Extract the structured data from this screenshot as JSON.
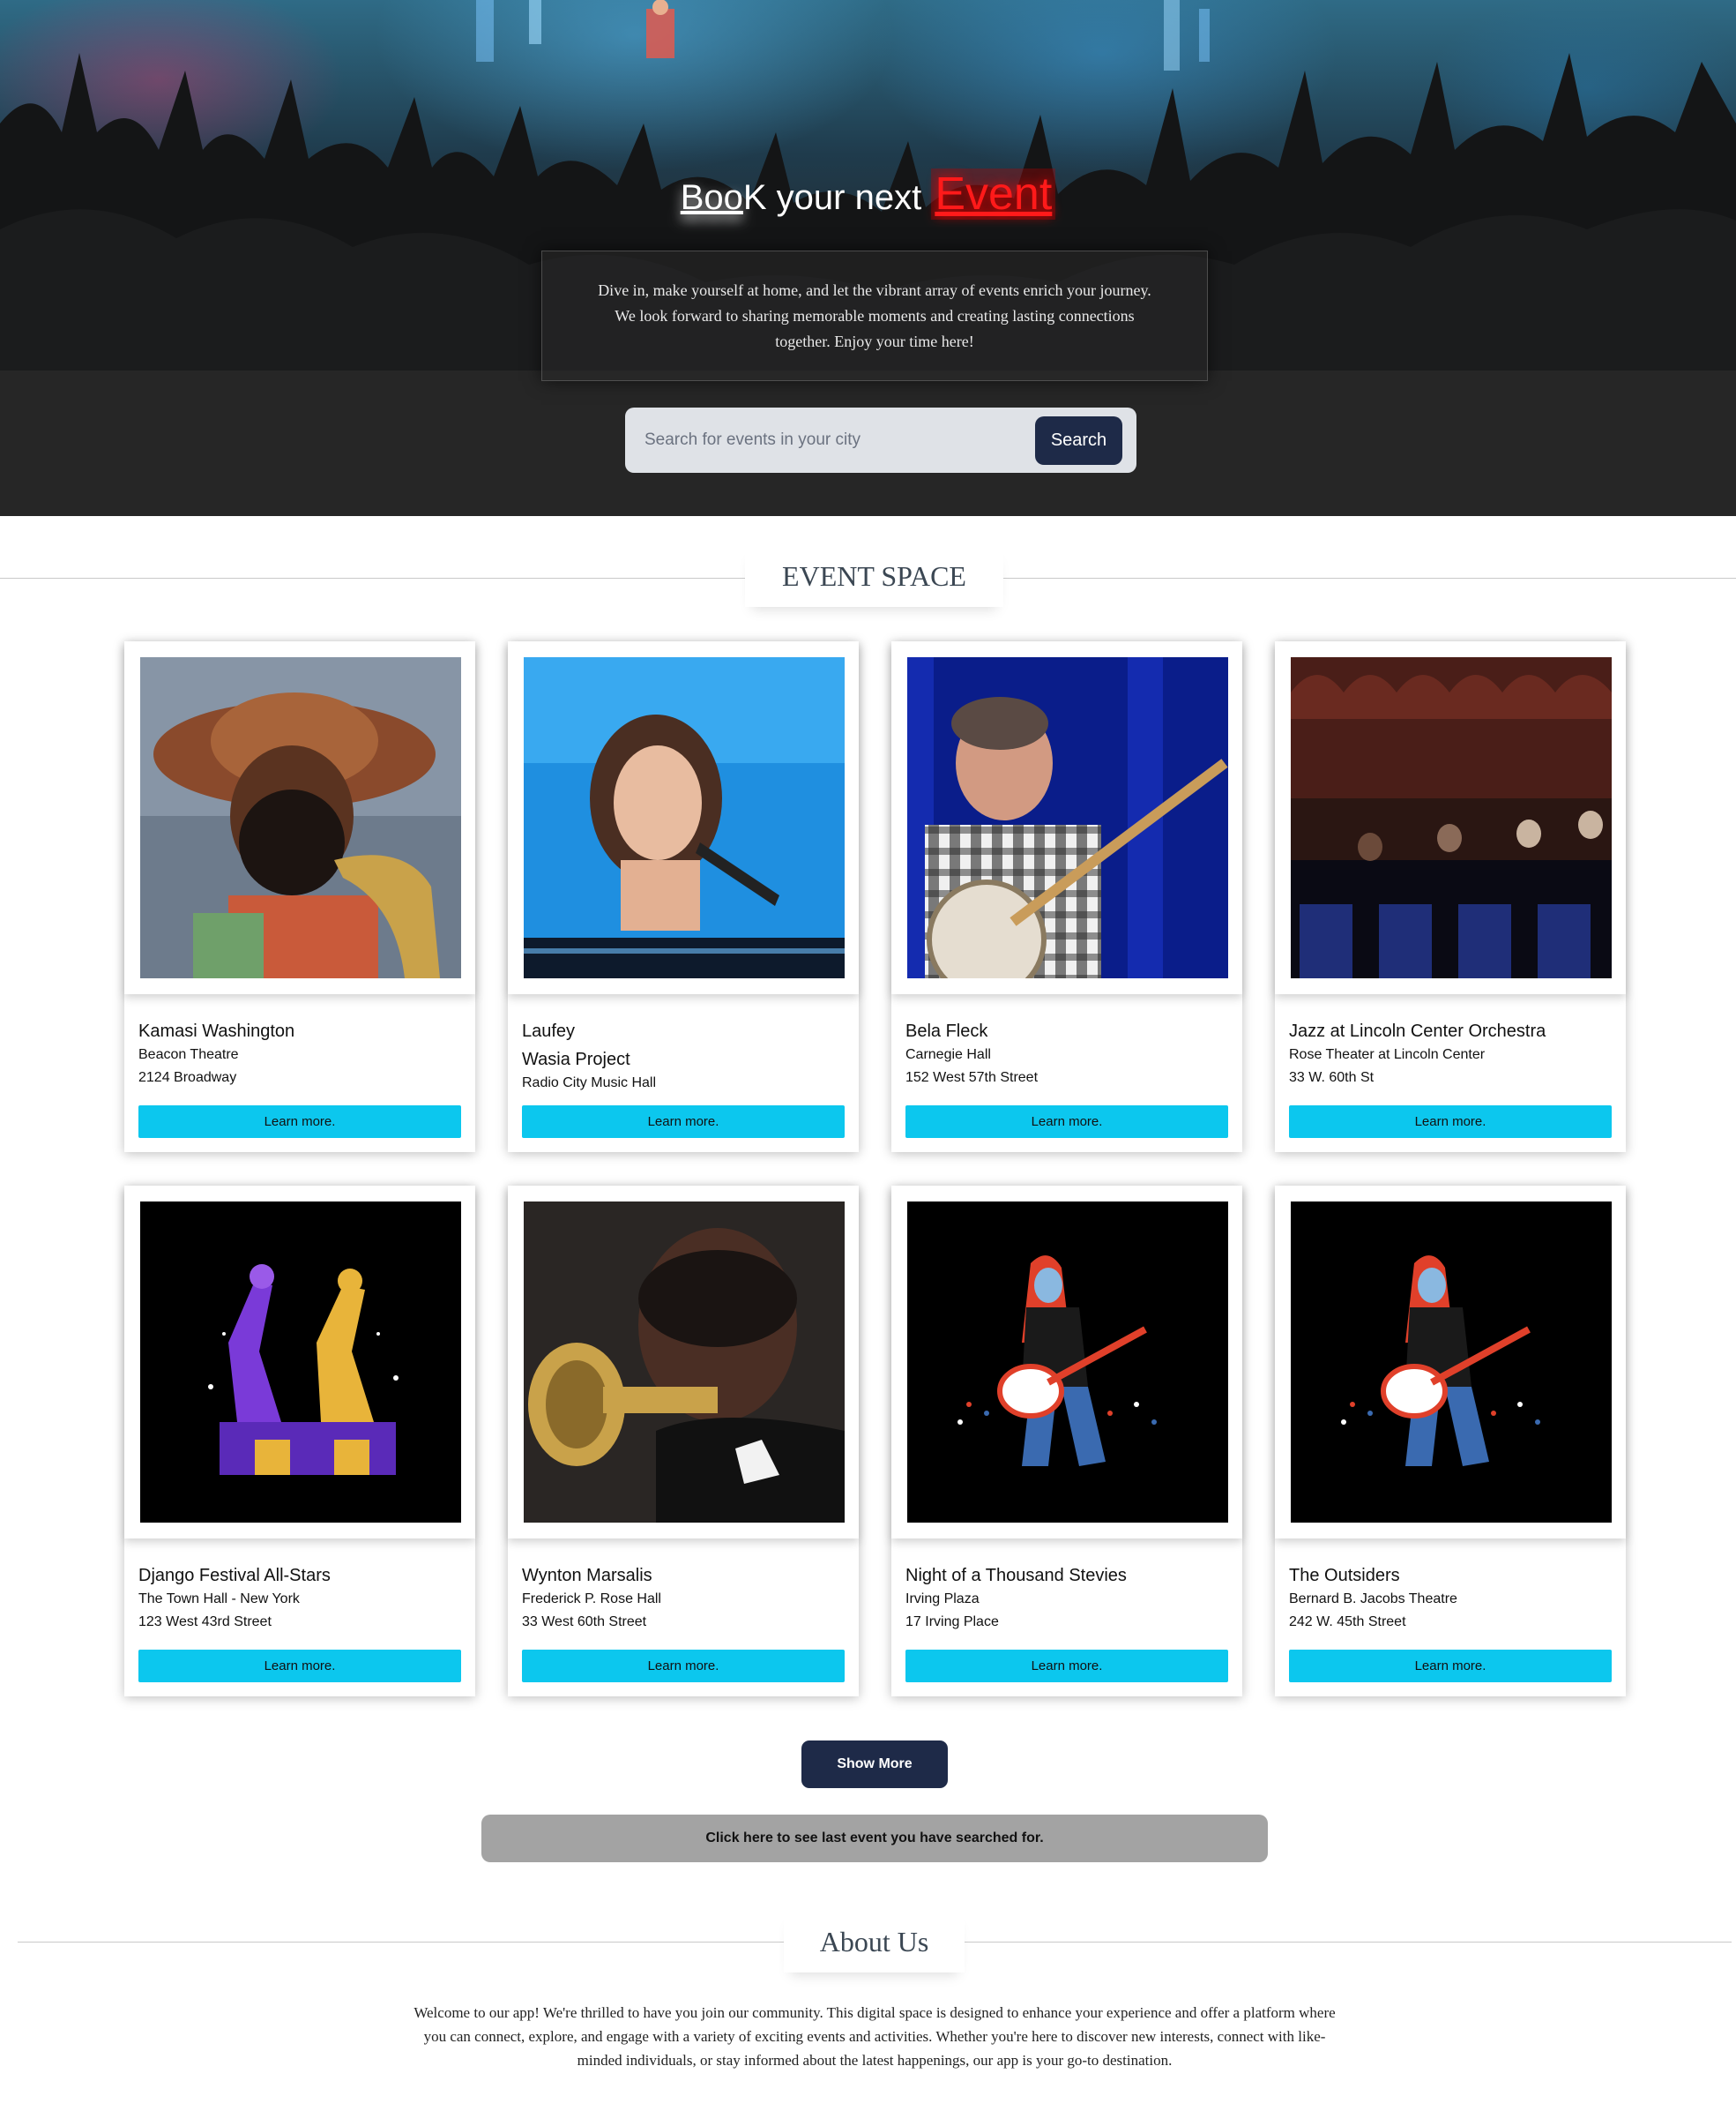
{
  "hero": {
    "title_part1": "Boo",
    "title_part2": "K your next ",
    "title_highlight": "Event",
    "description": "Dive in, make yourself at home, and let the vibrant array of events enrich your journey. We look forward to sharing memorable moments and creating lasting connections together. Enjoy your time here!",
    "search_placeholder": "Search for events in your city",
    "search_button": "Search"
  },
  "event_section": {
    "heading": "EVENT SPACE"
  },
  "events": [
    {
      "name": "Kamasi Washington",
      "venue": "Beacon Theatre",
      "address": "2124 Broadway",
      "button": "Learn more.",
      "image": "saxophonist-photo"
    },
    {
      "name": "Laufey",
      "subtitle": "Wasia Project",
      "venue": "Radio City Music Hall",
      "button": "Learn more.",
      "image": "singer-photo"
    },
    {
      "name": "Bela Fleck",
      "venue": "Carnegie Hall",
      "address": "152 West 57th Street",
      "button": "Learn more.",
      "image": "banjo-player-photo"
    },
    {
      "name": "Jazz at Lincoln Center Orchestra",
      "venue": "Rose Theater at Lincoln Center",
      "address": "33 W. 60th St",
      "button": "Learn more.",
      "image": "orchestra-photo"
    },
    {
      "name": "Django Festival All-Stars",
      "venue": "The Town Hall - New York",
      "address": "123 West 43rd Street",
      "button": "Learn more.",
      "image": "dancers-illustration"
    },
    {
      "name": "Wynton Marsalis",
      "venue": "Frederick P. Rose Hall",
      "address": "33 West 60th Street",
      "button": "Learn more.",
      "image": "trumpeter-photo"
    },
    {
      "name": "Night of a Thousand Stevies",
      "venue": "Irving Plaza",
      "address": "17 Irving Place",
      "button": "Learn more.",
      "image": "guitarist-illustration"
    },
    {
      "name": "The Outsiders",
      "venue": "Bernard B. Jacobs Theatre",
      "address": "242 W. 45th Street",
      "button": "Learn more.",
      "image": "guitarist-illustration"
    }
  ],
  "actions": {
    "show_more": "Show More",
    "last_search": "Click here to see last event you have searched for."
  },
  "about": {
    "heading": "About Us",
    "text": "Welcome to our app! We're thrilled to have you join our community. This digital space is designed to enhance your experience and offer a platform where you can connect, explore, and engage with a variety of exciting events and activities. Whether you're here to discover new interests, connect with like-minded individuals, or stay informed about the latest happenings, our app is your go-to destination."
  },
  "colors": {
    "accent": "#0cc7ee",
    "navy": "#1e2a48",
    "highlight_red": "#ff1a1a"
  }
}
